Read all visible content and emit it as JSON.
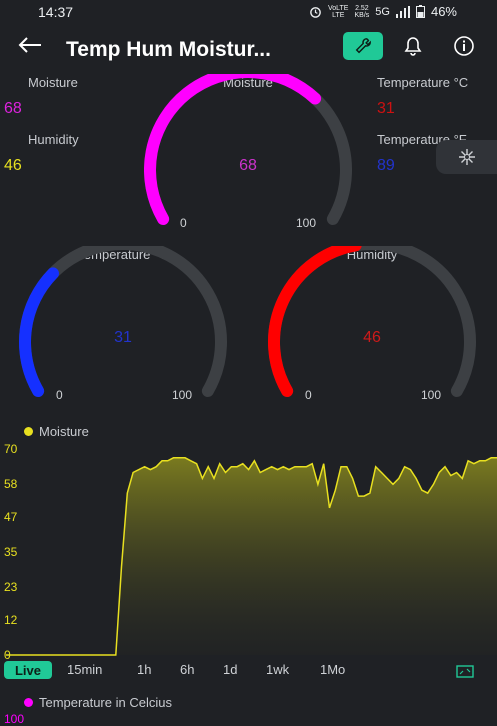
{
  "status": {
    "time": "14:37",
    "battery": "46%",
    "network": "5G",
    "speed_value": "2.52",
    "speed_unit": "KB/s",
    "volte_top": "VoLTE",
    "volte_bottom": "LTE"
  },
  "appbar": {
    "title": "Temp Hum Moistur..."
  },
  "widgets": {
    "moisture_label": "Moisture",
    "moisture_value": "68",
    "humidity_label": "Humidity",
    "humidity_value": "46",
    "temp_c_label": "Temperature °C",
    "temp_c_value": "31",
    "temp_f_label": "Temperature °F",
    "temp_f_value": "89"
  },
  "gauges": [
    {
      "title": "Moisture",
      "value": "68",
      "min": "0",
      "max": "100",
      "level": 0.68,
      "color": "#ff00ff",
      "value_color": "#cc33cc"
    },
    {
      "title": "Temperature °C",
      "value": "31",
      "min": "0",
      "max": "100",
      "level": 0.31,
      "color": "#1530ff",
      "value_color": "#2233cc"
    },
    {
      "title": "Humidity",
      "value": "46",
      "min": "0",
      "max": "100",
      "level": 0.46,
      "color": "#ff0000",
      "value_color": "#cc1a1a"
    }
  ],
  "chart_data": {
    "type": "area",
    "legend": "Moisture",
    "series_color": "#e8e020",
    "y_ticks": [
      "70",
      "58",
      "47",
      "35",
      "23",
      "12",
      "0"
    ],
    "ylim": [
      0,
      70
    ],
    "values": [
      0,
      0,
      0,
      0,
      0,
      0,
      0,
      0,
      0,
      0,
      0,
      0,
      0,
      0,
      0,
      0,
      0,
      0,
      0,
      0,
      30,
      55,
      62,
      63,
      64,
      63,
      64,
      66,
      66,
      67,
      67,
      67,
      66,
      65,
      60,
      64,
      60,
      65,
      62,
      64,
      64,
      65,
      63,
      66,
      62,
      63,
      64,
      63,
      64,
      63,
      64,
      64,
      64,
      65,
      58,
      65,
      50,
      56,
      64,
      64,
      60,
      54,
      54,
      55,
      64,
      62,
      60,
      58,
      60,
      64,
      63,
      60,
      56,
      55,
      58,
      62,
      64,
      61,
      62,
      60,
      66,
      65,
      66,
      66,
      67,
      67
    ],
    "ranges": [
      "Live",
      "15min",
      "1h",
      "6h",
      "1d",
      "1wk",
      "1Mo"
    ],
    "selected_range": "Live"
  },
  "chart2": {
    "legend": "Temperature in Celcius",
    "color": "#ff00ff",
    "first_tick": "100"
  }
}
